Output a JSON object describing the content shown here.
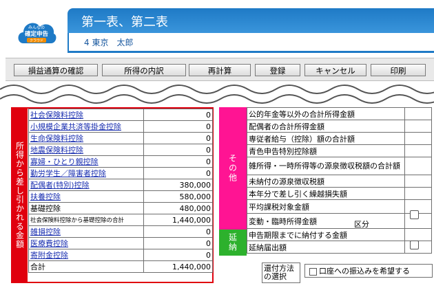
{
  "logo": {
    "line1": "みんなの",
    "line2": "確定申告",
    "line3": "クラウド"
  },
  "title": "第一表、第二表",
  "user": {
    "number": "4",
    "name": "東京　太郎"
  },
  "toolbar": {
    "buttons": [
      "損益通算の確認",
      "所得の内訳",
      "再計算",
      "登録",
      "キャンセル",
      "印刷"
    ]
  },
  "deductions": {
    "side_label": "所得から差し引かれる金額",
    "rows": [
      {
        "label": "社会保険料控除",
        "value": "0",
        "link": true
      },
      {
        "label": "小規模企業共済等掛金控除",
        "value": "0",
        "link": true
      },
      {
        "label": "生命保険料控除",
        "value": "0",
        "link": true
      },
      {
        "label": "地震保険料控除",
        "value": "0",
        "link": true
      },
      {
        "label": "寡婦・ひとり親控除",
        "value": "0",
        "link": true
      },
      {
        "label": "勤労学生／障害者控除",
        "value": "0",
        "link": true
      },
      {
        "label": "配偶者(特別)控除",
        "value": "380,000",
        "link": true
      },
      {
        "label": "扶養控除",
        "value": "580,000",
        "link": true
      },
      {
        "label": "基礎控除",
        "value": "480,000",
        "link": false
      },
      {
        "label": "社会保険料控除から基礎控除の合計",
        "value": "1,440,000",
        "link": false,
        "small": true
      },
      {
        "label": "雑損控除",
        "value": "0",
        "link": true
      },
      {
        "label": "医療費控除",
        "value": "0",
        "link": true
      },
      {
        "label": "寄附金控除",
        "value": "0",
        "link": true
      },
      {
        "label": "合計",
        "value": "1,440,000",
        "link": false
      }
    ]
  },
  "sono_label": "その他",
  "ennou_label": "延納",
  "other_rows": [
    "公的年金等以外の合計所得金額",
    "配偶者の合計所得金額",
    "専従者給与（控除）額の合計額",
    "青色申告特別控除額",
    "雑所得・一時所得等の源泉徴収税額の合計額",
    "未納付の源泉徴収税額",
    "本年分で差し引く繰越損失額",
    "平均課税対象金額",
    "変動・臨時所得金額"
  ],
  "kubun_label": "区分",
  "ennou_rows": [
    "申告期限までに納付する金額",
    "延納届出額"
  ],
  "refund": {
    "label": "還付方法の選択",
    "option": "口座への振込みを希望する"
  }
}
